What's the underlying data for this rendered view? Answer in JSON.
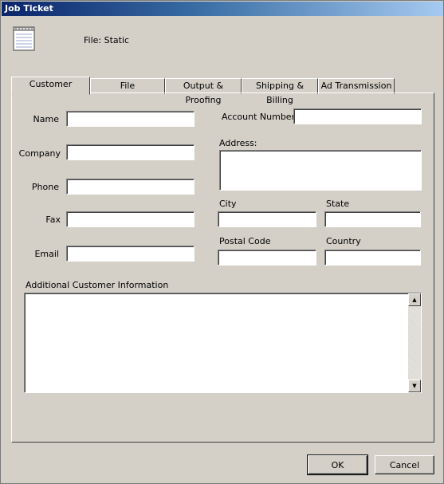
{
  "window": {
    "title": "Job Ticket"
  },
  "header": {
    "file_label": "File: Static",
    "icon": "document-icon"
  },
  "tabs": [
    {
      "label": "Customer",
      "active": true
    },
    {
      "label": "File",
      "active": false
    },
    {
      "label": "Output & Proofing",
      "active": false
    },
    {
      "label": "Shipping & Billing",
      "active": false
    },
    {
      "label": "Ad Transmission",
      "active": false
    }
  ],
  "customer": {
    "name_label": "Name",
    "company_label": "Company",
    "phone_label": "Phone",
    "fax_label": "Fax",
    "email_label": "Email",
    "account_number_label": "Account Number",
    "address_label": "Address:",
    "city_label": "City",
    "state_label": "State",
    "postal_code_label": "Postal Code",
    "country_label": "Country",
    "additional_info_label": "Additional Customer Information",
    "values": {
      "name": "",
      "company": "",
      "phone": "",
      "fax": "",
      "email": "",
      "account_number": "",
      "address": "",
      "city": "",
      "state": "",
      "postal_code": "",
      "country": "",
      "additional_info": ""
    }
  },
  "buttons": {
    "ok": "OK",
    "cancel": "Cancel"
  }
}
